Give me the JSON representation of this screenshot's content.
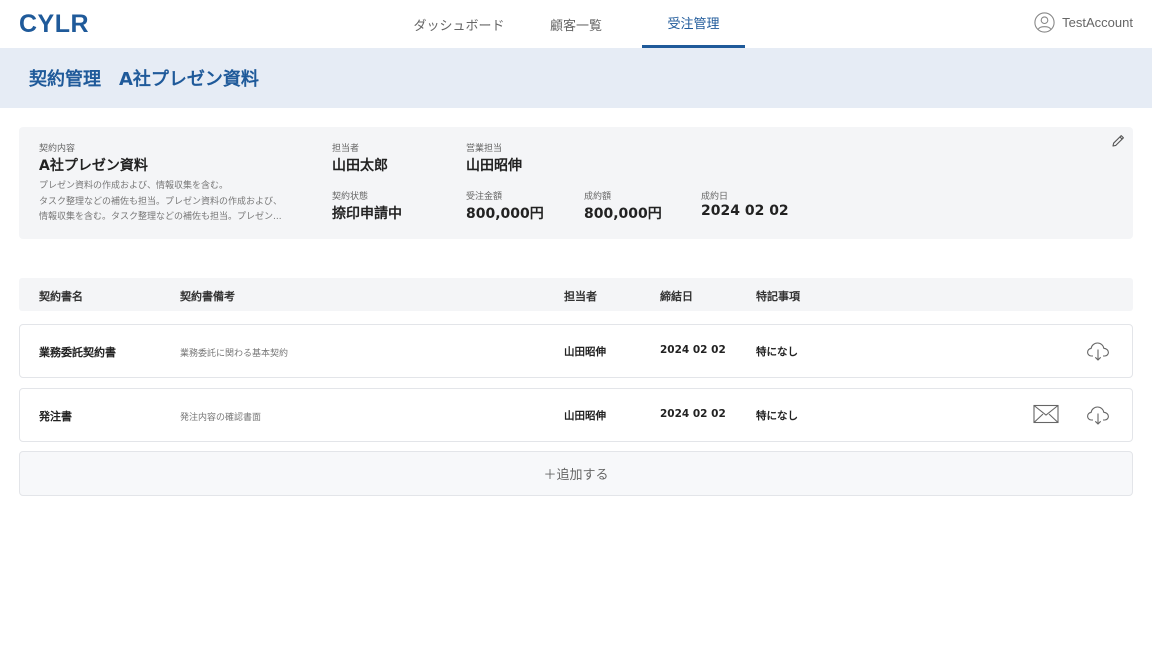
{
  "header": {
    "logo": "CYLR",
    "tabs": [
      {
        "label": "ダッシュボード",
        "active": false
      },
      {
        "label": "顧客一覧",
        "active": false
      },
      {
        "label": "受注管理",
        "active": true
      }
    ],
    "account_name": "TestAccount",
    "accent_color": "#1f5a9a"
  },
  "page": {
    "title": "契約管理　A社プレゼン資料"
  },
  "info": {
    "content_label": "契約内容",
    "content_value": "A社プレゼン資料",
    "description_lines": [
      "プレゼン資料の作成および、情報収集を含む。",
      "タスク整理などの補佐も担当。プレゼン資料の作成および、",
      "情報収集を含む。タスク整理などの補佐も担当。プレゼン..."
    ],
    "person_label": "担当者",
    "person_value": "山田太郎",
    "sales_label": "営業担当",
    "sales_value": "山田昭伸",
    "status_label": "契約状態",
    "status_value": "捺印申請中",
    "order_amount_label": "受注金額",
    "order_amount_value": "800,000円",
    "contract_amount_label": "成約額",
    "contract_amount_value": "800,000円",
    "contract_date_label": "成約日",
    "contract_date_value": "2024 02 02",
    "edit_icon": "pencil-icon"
  },
  "table": {
    "columns": [
      "契約書名",
      "契約書備考",
      "担当者",
      "締結日",
      "特記事項"
    ],
    "rows": [
      {
        "name": "業務委託契約書",
        "note": "業務委託に関わる基本契約",
        "person": "山田昭伸",
        "date": "2024 02 02",
        "special": "特になし",
        "icons": [
          "cloud-download-icon"
        ]
      },
      {
        "name": "発注書",
        "note": "発注内容の確認書面",
        "person": "山田昭伸",
        "date": "2024 02 02",
        "special": "特になし",
        "icons": [
          "mail-icon",
          "cloud-download-icon"
        ]
      }
    ]
  },
  "add_button": "＋追加する"
}
